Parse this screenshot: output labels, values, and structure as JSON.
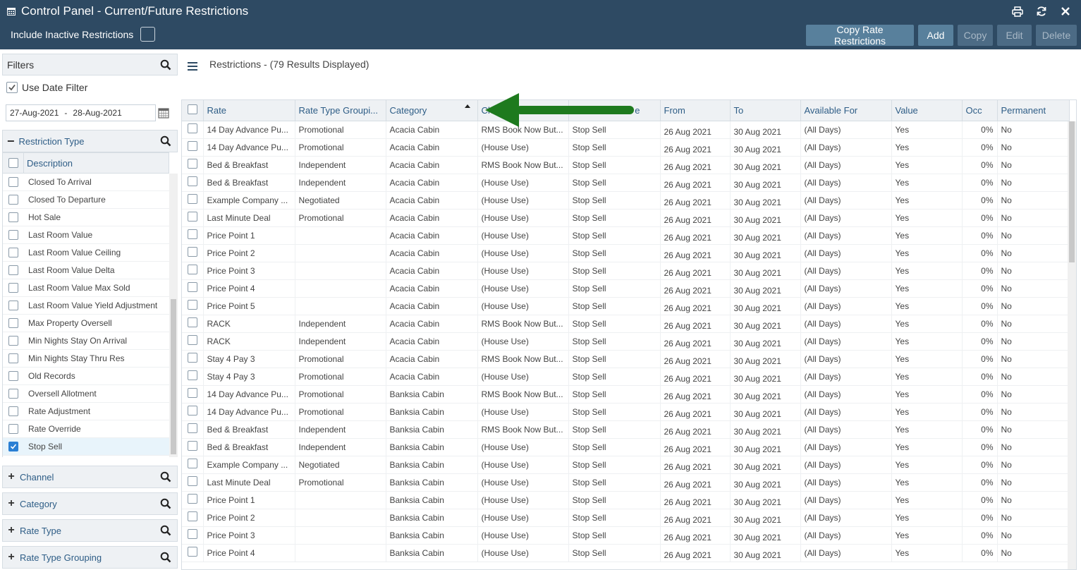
{
  "header": {
    "title": "Control Panel - Current/Future Restrictions",
    "include_inactive_label": "Include Inactive Restrictions",
    "buttons": {
      "copy_rate_restrictions": "Copy Rate Restrictions",
      "add": "Add",
      "copy": "Copy",
      "edit": "Edit",
      "delete": "Delete"
    },
    "icons": [
      "calendar-icon",
      "print-icon",
      "refresh-icon",
      "close-icon"
    ]
  },
  "filters": {
    "title": "Filters",
    "use_date_filter_label": "Use Date Filter",
    "date_from": "27-Aug-2021",
    "date_sep": "-",
    "date_to": "28-Aug-2021",
    "restriction_type": {
      "label": "Restriction Type",
      "description_header": "Description",
      "items": [
        "Closed To Arrival",
        "Closed To Departure",
        "Hot Sale",
        "Last Room Value",
        "Last Room Value Ceiling",
        "Last Room Value Delta",
        "Last Room Value Max Sold",
        "Last Room Value Yield Adjustment",
        "Max Property Oversell",
        "Min Nights Stay On Arrival",
        "Min Nights Stay Thru Res",
        "Old Records",
        "Oversell Allotment",
        "Rate Adjustment",
        "Rate Override",
        "Stop Sell"
      ],
      "selected": "Stop Sell"
    },
    "channel_label": "Channel",
    "category_label": "Category",
    "rate_type_label": "Rate Type",
    "rate_type_grouping_label": "Rate Type Grouping"
  },
  "main": {
    "results_text": "Restrictions - (79 Results Displayed)",
    "columns": [
      "Rate",
      "Rate Type Groupi...",
      "Category",
      "Ch",
      "",
      "e",
      "From",
      "To",
      "Available For",
      "Value",
      "Occ",
      "Permanent"
    ],
    "rows": [
      [
        "14 Day Advance Pu...",
        "Promotional",
        "Acacia Cabin",
        "RMS Book Now But...",
        "Stop Sell",
        "26 Aug 2021",
        "30 Aug 2021",
        "(All Days)",
        "Yes",
        "0%",
        "No"
      ],
      [
        "14 Day Advance Pu...",
        "Promotional",
        "Acacia Cabin",
        "(House Use)",
        "Stop Sell",
        "26 Aug 2021",
        "30 Aug 2021",
        "(All Days)",
        "Yes",
        "0%",
        "No"
      ],
      [
        "Bed & Breakfast",
        "Independent",
        "Acacia Cabin",
        "RMS Book Now But...",
        "Stop Sell",
        "26 Aug 2021",
        "30 Aug 2021",
        "(All Days)",
        "Yes",
        "0%",
        "No"
      ],
      [
        "Bed & Breakfast",
        "Independent",
        "Acacia Cabin",
        "(House Use)",
        "Stop Sell",
        "26 Aug 2021",
        "30 Aug 2021",
        "(All Days)",
        "Yes",
        "0%",
        "No"
      ],
      [
        "Example Company ...",
        "Negotiated",
        "Acacia Cabin",
        "(House Use)",
        "Stop Sell",
        "26 Aug 2021",
        "30 Aug 2021",
        "(All Days)",
        "Yes",
        "0%",
        "No"
      ],
      [
        "Last Minute Deal",
        "Promotional",
        "Acacia Cabin",
        "(House Use)",
        "Stop Sell",
        "26 Aug 2021",
        "30 Aug 2021",
        "(All Days)",
        "Yes",
        "0%",
        "No"
      ],
      [
        "Price Point 1",
        "",
        "Acacia Cabin",
        "(House Use)",
        "Stop Sell",
        "26 Aug 2021",
        "30 Aug 2021",
        "(All Days)",
        "Yes",
        "0%",
        "No"
      ],
      [
        "Price Point 2",
        "",
        "Acacia Cabin",
        "(House Use)",
        "Stop Sell",
        "26 Aug 2021",
        "30 Aug 2021",
        "(All Days)",
        "Yes",
        "0%",
        "No"
      ],
      [
        "Price Point 3",
        "",
        "Acacia Cabin",
        "(House Use)",
        "Stop Sell",
        "26 Aug 2021",
        "30 Aug 2021",
        "(All Days)",
        "Yes",
        "0%",
        "No"
      ],
      [
        "Price Point 4",
        "",
        "Acacia Cabin",
        "(House Use)",
        "Stop Sell",
        "26 Aug 2021",
        "30 Aug 2021",
        "(All Days)",
        "Yes",
        "0%",
        "No"
      ],
      [
        "Price Point 5",
        "",
        "Acacia Cabin",
        "(House Use)",
        "Stop Sell",
        "26 Aug 2021",
        "30 Aug 2021",
        "(All Days)",
        "Yes",
        "0%",
        "No"
      ],
      [
        "RACK",
        "Independent",
        "Acacia Cabin",
        "RMS Book Now But...",
        "Stop Sell",
        "26 Aug 2021",
        "30 Aug 2021",
        "(All Days)",
        "Yes",
        "0%",
        "No"
      ],
      [
        "RACK",
        "Independent",
        "Acacia Cabin",
        "(House Use)",
        "Stop Sell",
        "26 Aug 2021",
        "30 Aug 2021",
        "(All Days)",
        "Yes",
        "0%",
        "No"
      ],
      [
        "Stay 4 Pay 3",
        "Promotional",
        "Acacia Cabin",
        "RMS Book Now But...",
        "Stop Sell",
        "26 Aug 2021",
        "30 Aug 2021",
        "(All Days)",
        "Yes",
        "0%",
        "No"
      ],
      [
        "Stay 4 Pay 3",
        "Promotional",
        "Acacia Cabin",
        "(House Use)",
        "Stop Sell",
        "26 Aug 2021",
        "30 Aug 2021",
        "(All Days)",
        "Yes",
        "0%",
        "No"
      ],
      [
        "14 Day Advance Pu...",
        "Promotional",
        "Banksia Cabin",
        "RMS Book Now But...",
        "Stop Sell",
        "26 Aug 2021",
        "30 Aug 2021",
        "(All Days)",
        "Yes",
        "0%",
        "No"
      ],
      [
        "14 Day Advance Pu...",
        "Promotional",
        "Banksia Cabin",
        "(House Use)",
        "Stop Sell",
        "26 Aug 2021",
        "30 Aug 2021",
        "(All Days)",
        "Yes",
        "0%",
        "No"
      ],
      [
        "Bed & Breakfast",
        "Independent",
        "Banksia Cabin",
        "RMS Book Now But...",
        "Stop Sell",
        "26 Aug 2021",
        "30 Aug 2021",
        "(All Days)",
        "Yes",
        "0%",
        "No"
      ],
      [
        "Bed & Breakfast",
        "Independent",
        "Banksia Cabin",
        "(House Use)",
        "Stop Sell",
        "26 Aug 2021",
        "30 Aug 2021",
        "(All Days)",
        "Yes",
        "0%",
        "No"
      ],
      [
        "Example Company ...",
        "Negotiated",
        "Banksia Cabin",
        "(House Use)",
        "Stop Sell",
        "26 Aug 2021",
        "30 Aug 2021",
        "(All Days)",
        "Yes",
        "0%",
        "No"
      ],
      [
        "Last Minute Deal",
        "Promotional",
        "Banksia Cabin",
        "(House Use)",
        "Stop Sell",
        "26 Aug 2021",
        "30 Aug 2021",
        "(All Days)",
        "Yes",
        "0%",
        "No"
      ],
      [
        "Price Point 1",
        "",
        "Banksia Cabin",
        "(House Use)",
        "Stop Sell",
        "26 Aug 2021",
        "30 Aug 2021",
        "(All Days)",
        "Yes",
        "0%",
        "No"
      ],
      [
        "Price Point 2",
        "",
        "Banksia Cabin",
        "(House Use)",
        "Stop Sell",
        "26 Aug 2021",
        "30 Aug 2021",
        "(All Days)",
        "Yes",
        "0%",
        "No"
      ],
      [
        "Price Point 3",
        "",
        "Banksia Cabin",
        "(House Use)",
        "Stop Sell",
        "26 Aug 2021",
        "30 Aug 2021",
        "(All Days)",
        "Yes",
        "0%",
        "No"
      ],
      [
        "Price Point 4",
        "",
        "Banksia Cabin",
        "(House Use)",
        "Stop Sell",
        "26 Aug 2021",
        "30 Aug 2021",
        "(All Days)",
        "Yes",
        "0%",
        "No"
      ]
    ]
  },
  "colors": {
    "header_bg": "#2e4a63",
    "button_bg": "#58809c",
    "button_disabled_bg": "#4c6b85",
    "link_blue": "#2e5d86",
    "annotation_arrow": "#1e7a1e"
  }
}
